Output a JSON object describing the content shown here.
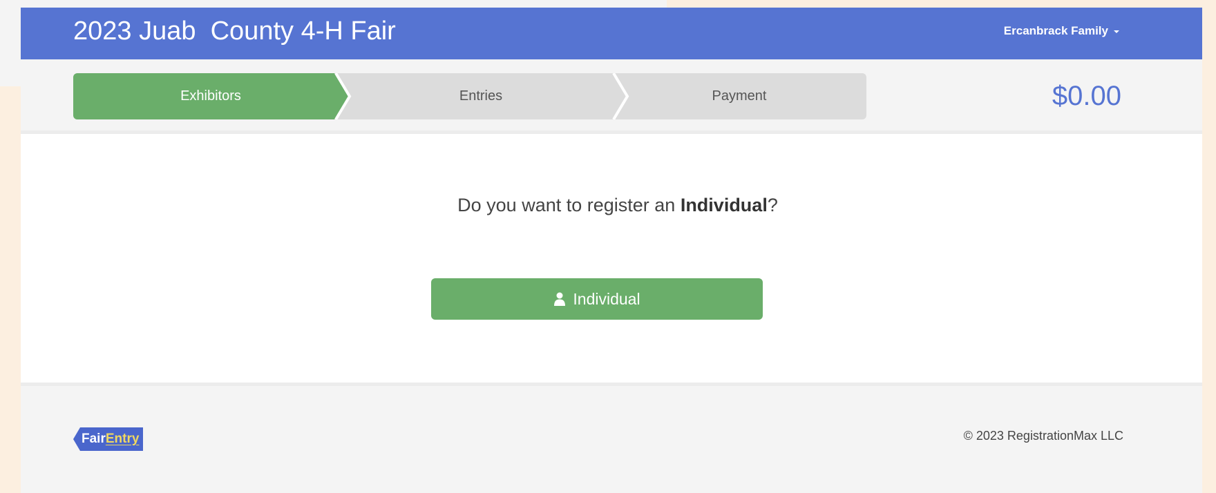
{
  "header": {
    "title": "2023 Juab  County 4-H Fair",
    "user_menu": "Ercanbrack Family",
    "brand_color": "#5674d2"
  },
  "steps": [
    {
      "label": "Exhibitors",
      "active": true
    },
    {
      "label": "Entries",
      "active": false
    },
    {
      "label": "Payment",
      "active": false
    }
  ],
  "cart_total": "$0.00",
  "main": {
    "question_prefix": "Do you want to register an ",
    "question_bold": "Individual",
    "question_suffix": "?",
    "individual_button": "Individual",
    "button_icon": "user-icon",
    "button_color": "#6aae6a"
  },
  "footer": {
    "logo_fair": "Fair",
    "logo_entry": "Entry",
    "copyright": "© 2023 RegistrationMax LLC"
  }
}
